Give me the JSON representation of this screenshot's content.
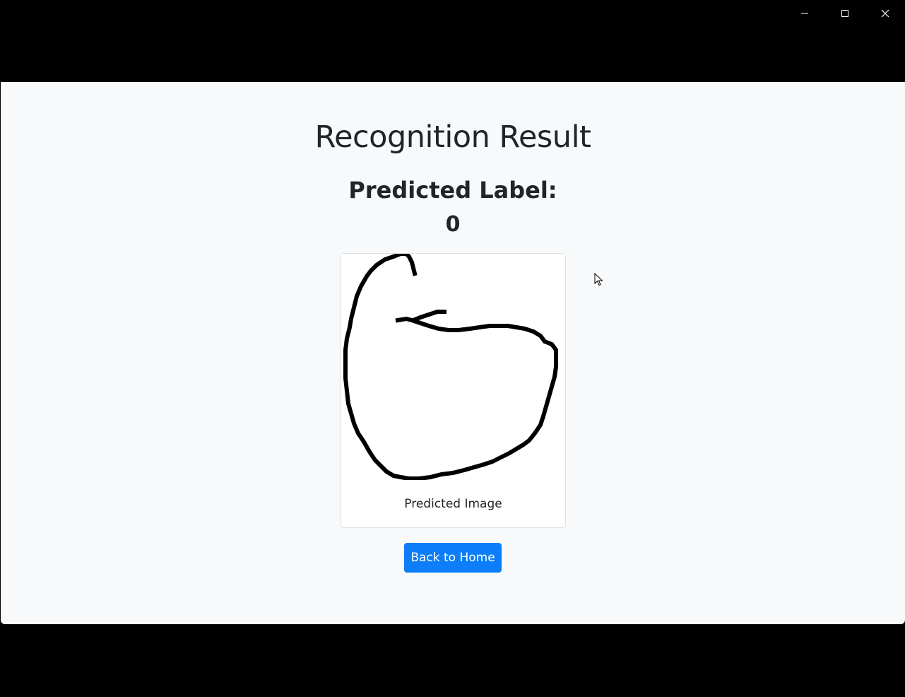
{
  "window": {
    "controls": [
      "minimize-icon",
      "maximize-icon",
      "close-icon"
    ],
    "background": "#000000"
  },
  "page": {
    "title": "Recognition Result",
    "label_heading": "Predicted Label:",
    "label_value": "0",
    "image_caption": "Predicted Image",
    "back_button": "Back to Home",
    "background": "#f8f9fa"
  },
  "colors": {
    "primary": "#0d7ef8",
    "text": "#212529",
    "card_border": "#dee2e6"
  }
}
